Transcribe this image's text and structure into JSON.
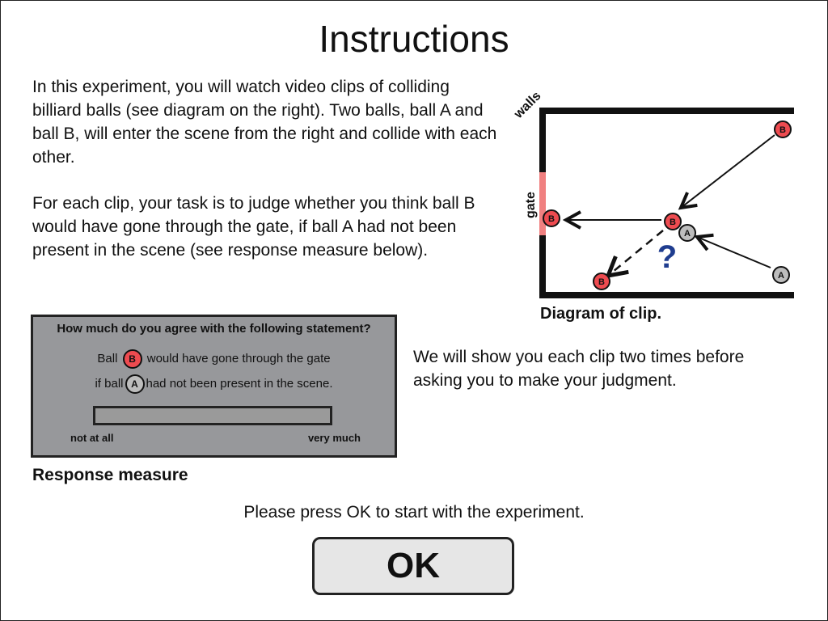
{
  "title": "Instructions",
  "paragraph1": "In this experiment, you will watch video clips of colliding billiard balls (see diagram on the right). Two balls, ball A and ball B, will enter the scene from the right and collide with each other.",
  "paragraph2": "For each clip, your task is to judge whether you think ball B would have gone through the gate, if ball A had not been present in the scene (see response measure below).",
  "diagram": {
    "walls_label": "walls",
    "gate_label": "gate",
    "ball_a_label": "A",
    "ball_b_label": "B",
    "question_mark": "?",
    "caption": "Diagram of clip.",
    "colors": {
      "ball_b": "#ee4b50",
      "ball_a": "#bdbdbd",
      "gate": "#f08080",
      "question": "#1f3d8f"
    }
  },
  "response": {
    "question": "How much do you agree with the following statement?",
    "statement_part1": "Ball",
    "statement_part2": "would have gone through the gate",
    "statement_part3": "if ball",
    "statement_part4": "had not been present in the scene.",
    "ball_b": "B",
    "ball_a": "A",
    "scale_left": "not at all",
    "scale_right": "very much",
    "caption": "Response measure"
  },
  "repeat_text": "We will show you each clip two times before asking you to make your judgment.",
  "press_text": "Please press OK to start with the experiment.",
  "ok_label": "OK"
}
